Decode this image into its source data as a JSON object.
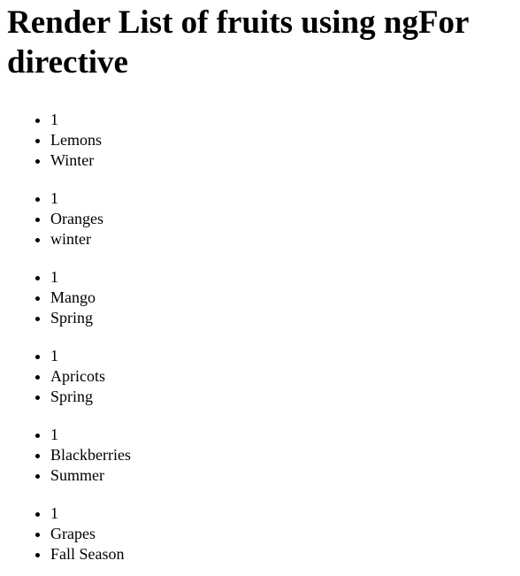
{
  "page": {
    "heading": "Render List of fruits using ngFor directive"
  },
  "fruits": [
    {
      "id": "1",
      "name": "Lemons",
      "season": "Winter"
    },
    {
      "id": "1",
      "name": "Oranges",
      "season": "winter"
    },
    {
      "id": "1",
      "name": "Mango",
      "season": "Spring"
    },
    {
      "id": "1",
      "name": "Apricots",
      "season": "Spring"
    },
    {
      "id": "1",
      "name": "Blackberries",
      "season": "Summer"
    },
    {
      "id": "1",
      "name": "Grapes",
      "season": "Fall Season"
    }
  ]
}
